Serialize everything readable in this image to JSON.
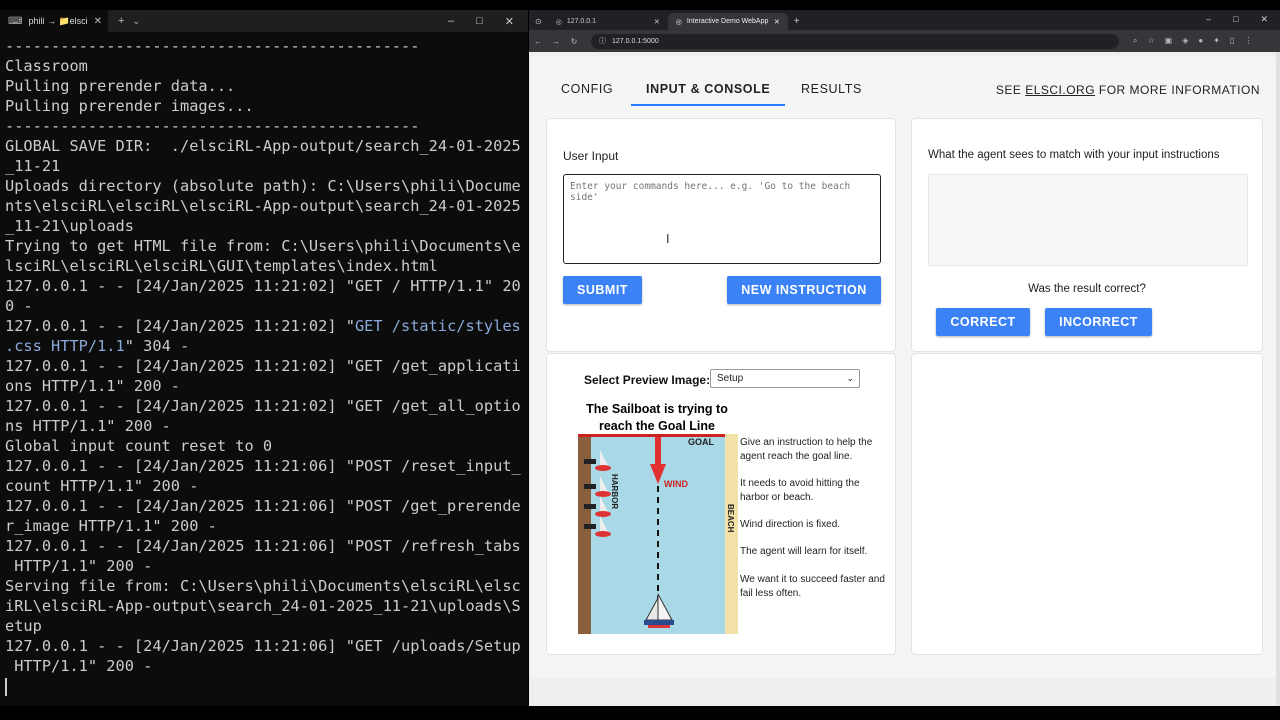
{
  "terminal": {
    "tab_title": "phili → 📁elsciRL",
    "lines": [
      "---------------------------------------------",
      "Classroom",
      "Pulling prerender data...",
      "Pulling prerender images...",
      "---------------------------------------------",
      "GLOBAL SAVE DIR:  ./elsciRL-App-output/search_24-01-2025",
      "_11-21",
      "Uploads directory (absolute path): C:\\Users\\phili\\Docume",
      "nts\\elsciRL\\elsciRL\\elsciRL-App-output\\search_24-01-2025",
      "_11-21\\uploads",
      "Trying to get HTML file from: C:\\Users\\phili\\Documents\\e",
      "lsciRL\\elsciRL\\elsciRL\\GUI\\templates\\index.html",
      "127.0.0.1 - - [24/Jan/2025 11:21:02] \"GET / HTTP/1.1\" 20",
      "0 -",
      "127.0.0.1 - - [24/Jan/2025 11:21:02] \"GET /static/styles",
      ".css HTTP/1.1\" 304 -",
      "127.0.0.1 - - [24/Jan/2025 11:21:02] \"GET /get_applicati",
      "ons HTTP/1.1\" 200 -",
      "127.0.0.1 - - [24/Jan/2025 11:21:02] \"GET /get_all_optio",
      "ns HTTP/1.1\" 200 -",
      "Global input count reset to 0",
      "127.0.0.1 - - [24/Jan/2025 11:21:06] \"POST /reset_input_",
      "count HTTP/1.1\" 200 -",
      "127.0.0.1 - - [24/Jan/2025 11:21:06] \"POST /get_prerende",
      "r_image HTTP/1.1\" 200 -",
      "127.0.0.1 - - [24/Jan/2025 11:21:06] \"POST /refresh_tabs",
      " HTTP/1.1\" 200 -",
      "Serving file from: C:\\Users\\phili\\Documents\\elsciRL\\elsc",
      "iRL\\elsciRL-App-output\\search_24-01-2025_11-21\\uploads\\S",
      "etup",
      "127.0.0.1 - - [24/Jan/2025 11:21:06] \"GET /uploads/Setup",
      " HTTP/1.1\" 200 -"
    ],
    "highlight": {
      "line": 14,
      "before": "127.0.0.1 - - [24/Jan/2025 11:21:02] \"",
      "marked": "GET /static/styles",
      "line2_marked": ".css HTTP/1.1",
      "line2_after": "\" 304 -"
    }
  },
  "browser": {
    "tabs": [
      {
        "title": "127.0.0.1"
      },
      {
        "title": "Interactive Demo WebApp"
      }
    ],
    "url": "127.0.0.1:5000"
  },
  "app": {
    "nav": {
      "config": "CONFIG",
      "input_console": "INPUT & CONSOLE",
      "results": "RESULTS",
      "see_prefix": "SEE",
      "see_link": "ELSCI.ORG",
      "see_suffix": "FOR MORE INFORMATION"
    },
    "user_input": {
      "label": "User Input",
      "placeholder": "Enter your commands here... e.g. 'Go to the beach side'",
      "submit": "SUBMIT",
      "new_instruction": "NEW INSTRUCTION"
    },
    "match": {
      "label": "What the agent sees to match with your input instructions",
      "question": "Was the result correct?",
      "correct": "CORRECT",
      "incorrect": "INCORRECT"
    },
    "preview": {
      "label": "Select Preview Image:",
      "selected": "Setup",
      "title": "The Sailboat is trying to reach the Goal Line",
      "map_labels": {
        "goal": "GOAL",
        "wind": "WIND",
        "harbor": "HARBOR",
        "beach": "BEACH"
      },
      "instructions": [
        "Give an instruction to help the agent reach the goal line.",
        "It needs to avoid hitting the harbor or beach.",
        "Wind direction is fixed.",
        "The agent will learn for itself.",
        "We want it to succeed faster and fail less often."
      ]
    }
  },
  "colors": {
    "accent": "#3b82f6",
    "tab_underline": "#2b79ff",
    "water": "#a9d8e6",
    "beach": "#f3e2a8",
    "harbor": "#8b5e3c",
    "wind": "#e03030"
  }
}
